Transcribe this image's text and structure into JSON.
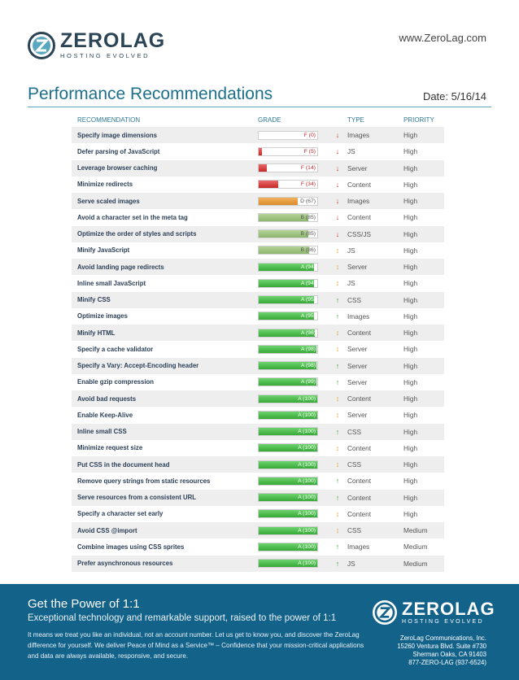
{
  "header": {
    "logo_name": "ZEROLAG",
    "logo_tagline": "HOSTING EVOLVED",
    "site_url": "www.ZeroLag.com",
    "title": "Performance Recommendations",
    "date": "Date: 5/16/14",
    "accent_color": "#1d6f8a"
  },
  "table": {
    "headers": {
      "recommendation": "RECOMMENDATION",
      "grade": "GRADE",
      "type": "TYPE",
      "priority": "PRIORITY"
    },
    "rows": [
      {
        "recommendation": "Specify image dimensions",
        "grade": "F (0)",
        "score": 0,
        "arrow": "down",
        "type": "Images",
        "priority": "High"
      },
      {
        "recommendation": "Defer parsing of JavaScript",
        "grade": "F (5)",
        "score": 5,
        "arrow": "down",
        "type": "JS",
        "priority": "High"
      },
      {
        "recommendation": "Leverage browser caching",
        "grade": "F (14)",
        "score": 14,
        "arrow": "down",
        "type": "Server",
        "priority": "High"
      },
      {
        "recommendation": "Minimize redirects",
        "grade": "F (34)",
        "score": 34,
        "arrow": "down",
        "type": "Content",
        "priority": "High"
      },
      {
        "recommendation": "Serve scaled images",
        "grade": "D (67)",
        "score": 67,
        "arrow": "down",
        "type": "Images",
        "priority": "High"
      },
      {
        "recommendation": "Avoid a character set in the meta tag",
        "grade": "B (85)",
        "score": 85,
        "arrow": "down",
        "type": "Content",
        "priority": "High"
      },
      {
        "recommendation": "Optimize the order of styles and scripts",
        "grade": "B (85)",
        "score": 85,
        "arrow": "down",
        "type": "CSS/JS",
        "priority": "High"
      },
      {
        "recommendation": "Minify JavaScript",
        "grade": "B (86)",
        "score": 86,
        "arrow": "both",
        "type": "JS",
        "priority": "High"
      },
      {
        "recommendation": "Avoid landing page redirects",
        "grade": "A (94)",
        "score": 94,
        "arrow": "both",
        "type": "Server",
        "priority": "High"
      },
      {
        "recommendation": "Inline small JavaScript",
        "grade": "A (94)",
        "score": 94,
        "arrow": "both",
        "type": "JS",
        "priority": "High"
      },
      {
        "recommendation": "Minify CSS",
        "grade": "A (95)",
        "score": 95,
        "arrow": "up",
        "type": "CSS",
        "priority": "High"
      },
      {
        "recommendation": "Optimize images",
        "grade": "A (95)",
        "score": 95,
        "arrow": "up",
        "type": "Images",
        "priority": "High"
      },
      {
        "recommendation": "Minify HTML",
        "grade": "A (96)",
        "score": 96,
        "arrow": "both",
        "type": "Content",
        "priority": "High"
      },
      {
        "recommendation": "Specify a cache validator",
        "grade": "A (98)",
        "score": 98,
        "arrow": "both",
        "type": "Server",
        "priority": "High"
      },
      {
        "recommendation": "Specify a Vary: Accept-Encoding header",
        "grade": "A (98)",
        "score": 98,
        "arrow": "up",
        "type": "Server",
        "priority": "High"
      },
      {
        "recommendation": "Enable gzip compression",
        "grade": "A (99)",
        "score": 99,
        "arrow": "up",
        "type": "Server",
        "priority": "High"
      },
      {
        "recommendation": "Avoid bad requests",
        "grade": "A (100)",
        "score": 100,
        "arrow": "both",
        "type": "Content",
        "priority": "High"
      },
      {
        "recommendation": "Enable Keep-Alive",
        "grade": "A (100)",
        "score": 100,
        "arrow": "both",
        "type": "Server",
        "priority": "High"
      },
      {
        "recommendation": "Inline small CSS",
        "grade": "A (100)",
        "score": 100,
        "arrow": "up",
        "type": "CSS",
        "priority": "High"
      },
      {
        "recommendation": "Minimize request size",
        "grade": "A (100)",
        "score": 100,
        "arrow": "both",
        "type": "Content",
        "priority": "High"
      },
      {
        "recommendation": "Put CSS in the document head",
        "grade": "A (100)",
        "score": 100,
        "arrow": "both",
        "type": "CSS",
        "priority": "High"
      },
      {
        "recommendation": "Remove query strings from static resources",
        "grade": "A (100)",
        "score": 100,
        "arrow": "up",
        "type": "Content",
        "priority": "High"
      },
      {
        "recommendation": "Serve resources from a consistent URL",
        "grade": "A (100)",
        "score": 100,
        "arrow": "up",
        "type": "Content",
        "priority": "High"
      },
      {
        "recommendation": "Specify a character set early",
        "grade": "A (100)",
        "score": 100,
        "arrow": "both",
        "type": "Content",
        "priority": "High"
      },
      {
        "recommendation": "Avoid CSS @import",
        "grade": "A (100)",
        "score": 100,
        "arrow": "both",
        "type": "CSS",
        "priority": "Medium"
      },
      {
        "recommendation": "Combine images using CSS sprites",
        "grade": "A (100)",
        "score": 100,
        "arrow": "up",
        "type": "Images",
        "priority": "Medium"
      },
      {
        "recommendation": "Prefer asynchronous resources",
        "grade": "A (100)",
        "score": 100,
        "arrow": "up",
        "type": "JS",
        "priority": "Medium"
      }
    ]
  },
  "footer": {
    "background_color": "#13628a",
    "headline": "Get the Power of 1:1",
    "subheadline": "Exceptional technology and remarkable support, raised to the power of 1:1",
    "body": "It means we treat you like an individual, not an account number. Let us get to know you, and discover the ZeroLag difference for yourself. We deliver Peace of Mind as a Service™ – Confidence that your mission-critical applications and data are always available, responsive, and secure.",
    "logo_name": "ZEROLAG",
    "logo_tagline": "HOSTING EVOLVED",
    "address_lines": [
      "ZeroLag Communications, Inc.",
      "15260 Ventura Blvd. Suite #730",
      "Sherman Oaks, CA 91403",
      "877-ZERO-LAG (937-6524)"
    ]
  }
}
